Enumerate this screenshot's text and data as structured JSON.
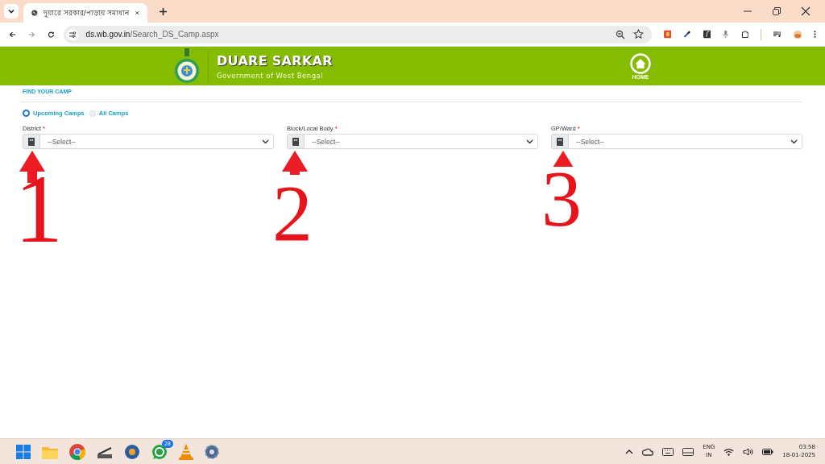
{
  "browser": {
    "tab_title": "দুয়ারে সরকার/পাড়ায় সমাধান",
    "url_host": "ds.wb.gov.in",
    "url_path": "/Search_DS_Camp.aspx"
  },
  "header": {
    "title": "DUARE SARKAR",
    "subtitle": "Government of West Bengal",
    "home_label": "HOME"
  },
  "section_title": "FIND YOUR CAMP",
  "camp_filter": [
    {
      "label": "Upcoming Camps",
      "selected": true
    },
    {
      "label": "All Camps",
      "selected": false
    }
  ],
  "fields": [
    {
      "label": "District",
      "required": "*",
      "placeholder": "--Select--"
    },
    {
      "label": "Block/Local Body",
      "required": "*",
      "placeholder": "--Select--"
    },
    {
      "label": "GP/Ward",
      "required": "*",
      "placeholder": "--Select--"
    }
  ],
  "annotations": [
    "1",
    "2",
    "3"
  ],
  "taskbar": {
    "whatsapp_badge": "28",
    "language": "ENG",
    "region": "IN",
    "time": "03:58",
    "date": "18-01-2025"
  }
}
